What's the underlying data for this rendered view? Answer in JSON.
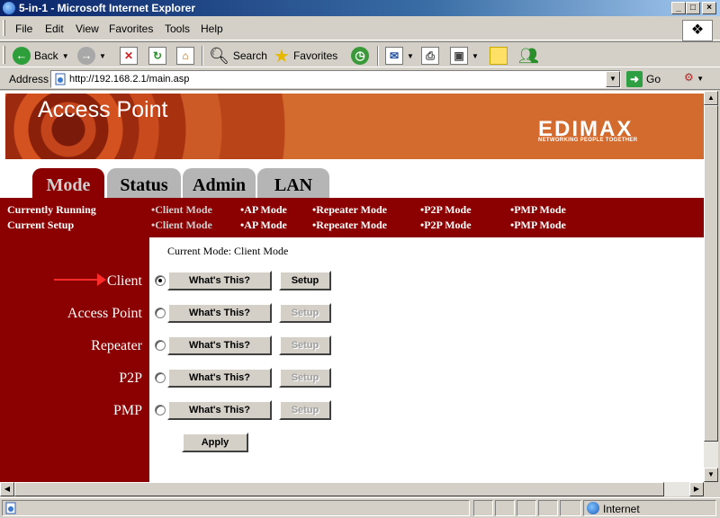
{
  "window": {
    "title": "5-in-1 - Microsoft Internet Explorer"
  },
  "menu": {
    "items": [
      "File",
      "Edit",
      "View",
      "Favorites",
      "Tools",
      "Help"
    ]
  },
  "toolbar": {
    "back": "Back",
    "search": "Search",
    "favorites": "Favorites"
  },
  "address": {
    "label": "Address",
    "url": "http://192.168.2.1/main.asp",
    "go": "Go"
  },
  "page": {
    "banner_title": "Access Point",
    "logo": "EDIMAX",
    "logo_tagline": "NETWORKING PEOPLE TOGETHER",
    "tabs": [
      "Mode",
      "Status",
      "Admin",
      "LAN"
    ],
    "active_tab": "Mode",
    "info": {
      "running_label": "Currently Running",
      "setup_label": "Current Setup",
      "running": [
        "•Client Mode",
        "•AP Mode",
        "•Repeater Mode",
        "•P2P Mode",
        "•PMP Mode"
      ],
      "setup": [
        "•Client Mode",
        "•AP Mode",
        "•Repeater Mode",
        "•P2P Mode",
        "•PMP Mode"
      ]
    },
    "current_mode": "Current Mode: Client Mode",
    "modes": [
      {
        "label": "Client",
        "selected": true,
        "whats_this": "What's This?",
        "setup": "Setup",
        "setup_enabled": true
      },
      {
        "label": "Access Point",
        "selected": false,
        "whats_this": "What's This?",
        "setup": "Setup",
        "setup_enabled": false
      },
      {
        "label": "Repeater",
        "selected": false,
        "whats_this": "What's This?",
        "setup": "Setup",
        "setup_enabled": false
      },
      {
        "label": "P2P",
        "selected": false,
        "whats_this": "What's This?",
        "setup": "Setup",
        "setup_enabled": false
      },
      {
        "label": "PMP",
        "selected": false,
        "whats_this": "What's This?",
        "setup": "Setup",
        "setup_enabled": false
      }
    ],
    "apply": "Apply"
  },
  "status": {
    "zone": "Internet"
  },
  "colors": {
    "brand_red": "#8b0000",
    "title_blue": "#0a246a"
  }
}
